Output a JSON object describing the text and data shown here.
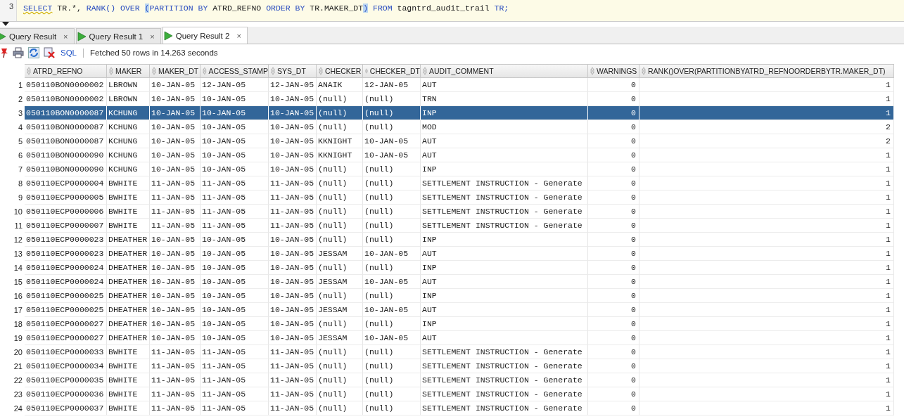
{
  "editor": {
    "line_number": "3",
    "sql": [
      {
        "kind": "keyword",
        "text": "SELECT"
      },
      {
        "kind": "plain",
        "text": " TR.*, "
      },
      {
        "kind": "keyword",
        "text": "RANK() OVER "
      },
      {
        "kind": "paren",
        "text": "("
      },
      {
        "kind": "keyword",
        "text": "PARTITION BY"
      },
      {
        "kind": "plain",
        "text": " ATRD_REFNO "
      },
      {
        "kind": "keyword",
        "text": "ORDER BY"
      },
      {
        "kind": "plain",
        "text": " TR.MAKER_DT"
      },
      {
        "kind": "paren",
        "text": ")"
      },
      {
        "kind": "keyword",
        "text": " FROM"
      },
      {
        "kind": "plain",
        "text": " tagntrd_audit_trail "
      },
      {
        "kind": "keyword",
        "text": "TR;"
      }
    ]
  },
  "tabs": [
    {
      "label": "Query Result",
      "close": "×",
      "selected": false
    },
    {
      "label": "Query Result 1",
      "close": "×",
      "selected": false
    },
    {
      "label": "Query Result 2",
      "close": "×",
      "selected": true
    }
  ],
  "toolbar": {
    "sql_link": "SQL",
    "status": "Fetched 50 rows in 14.263 seconds"
  },
  "table": {
    "columns": [
      {
        "label": "ATRD_REFNO",
        "kind": "text"
      },
      {
        "label": "MAKER",
        "kind": "text"
      },
      {
        "label": "MAKER_DT",
        "kind": "text"
      },
      {
        "label": "ACCESS_STAMP",
        "kind": "text"
      },
      {
        "label": "SYS_DT",
        "kind": "text"
      },
      {
        "label": "CHECKER",
        "kind": "text"
      },
      {
        "label": "CHECKER_DT",
        "kind": "text"
      },
      {
        "label": "AUDIT_COMMENT",
        "kind": "text"
      },
      {
        "label": "WARNINGS",
        "kind": "number"
      },
      {
        "label": "RANK()OVER(PARTITIONBYATRD_REFNOORDERBYTR.MAKER_DT)",
        "kind": "number"
      }
    ],
    "rows": [
      {
        "number": "1",
        "selected": false,
        "cells": [
          "050110BON0000002",
          "LBROWN",
          "10-JAN-05",
          "12-JAN-05",
          "12-JAN-05",
          "ANAIK",
          "12-JAN-05",
          "AUT",
          "0",
          "1"
        ]
      },
      {
        "number": "2",
        "selected": false,
        "cells": [
          "050110BON0000002",
          "LBROWN",
          "10-JAN-05",
          "10-JAN-05",
          "10-JAN-05",
          "(null)",
          "(null)",
          "TRN",
          "0",
          "1"
        ]
      },
      {
        "number": "3",
        "selected": true,
        "cells": [
          "050110BON0000087",
          "KCHUNG",
          "10-JAN-05",
          "10-JAN-05",
          "10-JAN-05",
          "(null)",
          "(null)",
          "INP",
          "0",
          "1"
        ]
      },
      {
        "number": "4",
        "selected": false,
        "cells": [
          "050110BON0000087",
          "KCHUNG",
          "10-JAN-05",
          "10-JAN-05",
          "10-JAN-05",
          "(null)",
          "(null)",
          "MOD",
          "0",
          "2"
        ]
      },
      {
        "number": "5",
        "selected": false,
        "cells": [
          "050110BON0000087",
          "KCHUNG",
          "10-JAN-05",
          "10-JAN-05",
          "10-JAN-05",
          "KKNIGHT",
          "10-JAN-05",
          "AUT",
          "0",
          "2"
        ]
      },
      {
        "number": "6",
        "selected": false,
        "cells": [
          "050110BON0000090",
          "KCHUNG",
          "10-JAN-05",
          "10-JAN-05",
          "10-JAN-05",
          "KKNIGHT",
          "10-JAN-05",
          "AUT",
          "0",
          "1"
        ]
      },
      {
        "number": "7",
        "selected": false,
        "cells": [
          "050110BON0000090",
          "KCHUNG",
          "10-JAN-05",
          "10-JAN-05",
          "10-JAN-05",
          "(null)",
          "(null)",
          "INP",
          "0",
          "1"
        ]
      },
      {
        "number": "8",
        "selected": false,
        "cells": [
          "050110ECP0000004",
          "BWHITE",
          "11-JAN-05",
          "11-JAN-05",
          "11-JAN-05",
          "(null)",
          "(null)",
          "SETTLEMENT INSTRUCTION - Generate",
          "0",
          "1"
        ]
      },
      {
        "number": "9",
        "selected": false,
        "cells": [
          "050110ECP0000005",
          "BWHITE",
          "11-JAN-05",
          "11-JAN-05",
          "11-JAN-05",
          "(null)",
          "(null)",
          "SETTLEMENT INSTRUCTION - Generate",
          "0",
          "1"
        ]
      },
      {
        "number": "10",
        "selected": false,
        "cells": [
          "050110ECP0000006",
          "BWHITE",
          "11-JAN-05",
          "11-JAN-05",
          "11-JAN-05",
          "(null)",
          "(null)",
          "SETTLEMENT INSTRUCTION - Generate",
          "0",
          "1"
        ]
      },
      {
        "number": "11",
        "selected": false,
        "cells": [
          "050110ECP0000007",
          "BWHITE",
          "11-JAN-05",
          "11-JAN-05",
          "11-JAN-05",
          "(null)",
          "(null)",
          "SETTLEMENT INSTRUCTION - Generate",
          "0",
          "1"
        ]
      },
      {
        "number": "12",
        "selected": false,
        "cells": [
          "050110ECP0000023",
          "DHEATHER",
          "10-JAN-05",
          "10-JAN-05",
          "10-JAN-05",
          "(null)",
          "(null)",
          "INP",
          "0",
          "1"
        ]
      },
      {
        "number": "13",
        "selected": false,
        "cells": [
          "050110ECP0000023",
          "DHEATHER",
          "10-JAN-05",
          "10-JAN-05",
          "10-JAN-05",
          "JESSAM",
          "10-JAN-05",
          "AUT",
          "0",
          "1"
        ]
      },
      {
        "number": "14",
        "selected": false,
        "cells": [
          "050110ECP0000024",
          "DHEATHER",
          "10-JAN-05",
          "10-JAN-05",
          "10-JAN-05",
          "(null)",
          "(null)",
          "INP",
          "0",
          "1"
        ]
      },
      {
        "number": "15",
        "selected": false,
        "cells": [
          "050110ECP0000024",
          "DHEATHER",
          "10-JAN-05",
          "10-JAN-05",
          "10-JAN-05",
          "JESSAM",
          "10-JAN-05",
          "AUT",
          "0",
          "1"
        ]
      },
      {
        "number": "16",
        "selected": false,
        "cells": [
          "050110ECP0000025",
          "DHEATHER",
          "10-JAN-05",
          "10-JAN-05",
          "10-JAN-05",
          "(null)",
          "(null)",
          "INP",
          "0",
          "1"
        ]
      },
      {
        "number": "17",
        "selected": false,
        "cells": [
          "050110ECP0000025",
          "DHEATHER",
          "10-JAN-05",
          "10-JAN-05",
          "10-JAN-05",
          "JESSAM",
          "10-JAN-05",
          "AUT",
          "0",
          "1"
        ]
      },
      {
        "number": "18",
        "selected": false,
        "cells": [
          "050110ECP0000027",
          "DHEATHER",
          "10-JAN-05",
          "10-JAN-05",
          "10-JAN-05",
          "(null)",
          "(null)",
          "INP",
          "0",
          "1"
        ]
      },
      {
        "number": "19",
        "selected": false,
        "cells": [
          "050110ECP0000027",
          "DHEATHER",
          "10-JAN-05",
          "10-JAN-05",
          "10-JAN-05",
          "JESSAM",
          "10-JAN-05",
          "AUT",
          "0",
          "1"
        ]
      },
      {
        "number": "20",
        "selected": false,
        "cells": [
          "050110ECP0000033",
          "BWHITE",
          "11-JAN-05",
          "11-JAN-05",
          "11-JAN-05",
          "(null)",
          "(null)",
          "SETTLEMENT INSTRUCTION - Generate",
          "0",
          "1"
        ]
      },
      {
        "number": "21",
        "selected": false,
        "cells": [
          "050110ECP0000034",
          "BWHITE",
          "11-JAN-05",
          "11-JAN-05",
          "11-JAN-05",
          "(null)",
          "(null)",
          "SETTLEMENT INSTRUCTION - Generate",
          "0",
          "1"
        ]
      },
      {
        "number": "22",
        "selected": false,
        "cells": [
          "050110ECP0000035",
          "BWHITE",
          "11-JAN-05",
          "11-JAN-05",
          "11-JAN-05",
          "(null)",
          "(null)",
          "SETTLEMENT INSTRUCTION - Generate",
          "0",
          "1"
        ]
      },
      {
        "number": "23",
        "selected": false,
        "cells": [
          "050110ECP0000036",
          "BWHITE",
          "11-JAN-05",
          "11-JAN-05",
          "11-JAN-05",
          "(null)",
          "(null)",
          "SETTLEMENT INSTRUCTION - Generate",
          "0",
          "1"
        ]
      },
      {
        "number": "24",
        "selected": false,
        "cells": [
          "050110ECP0000037",
          "BWHITE",
          "11-JAN-05",
          "11-JAN-05",
          "11-JAN-05",
          "(null)",
          "(null)",
          "SETTLEMENT INSTRUCTION - Generate",
          "0",
          "1"
        ]
      }
    ]
  }
}
